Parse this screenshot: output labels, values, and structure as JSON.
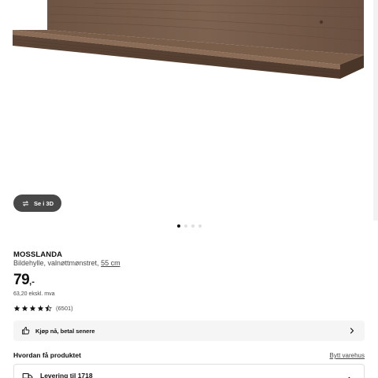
{
  "product": {
    "name": "MOSSLANDA",
    "description": "Bildehylle, valnøttmønstret,",
    "size": "55 cm",
    "price": "79",
    "price_suffix": ",-",
    "price_ex_vat": "63,20 ekskl. mva",
    "rating_stars": 4.5,
    "review_count": "(6501)"
  },
  "gallery": {
    "view_3d_label": "Se i 3D",
    "slide_count": 4,
    "active_slide": 1
  },
  "actions": {
    "buy_now_label": "Kjøp nå, betal senere"
  },
  "fulfillment": {
    "heading": "Hvordan få produktet",
    "change_store_label": "Bytt varehus",
    "delivery_label": "Levering til 1718"
  },
  "colors": {
    "pill_bg": "#484848",
    "wood_dark": "#5b4434",
    "wood_mid": "#7a5e4a"
  }
}
